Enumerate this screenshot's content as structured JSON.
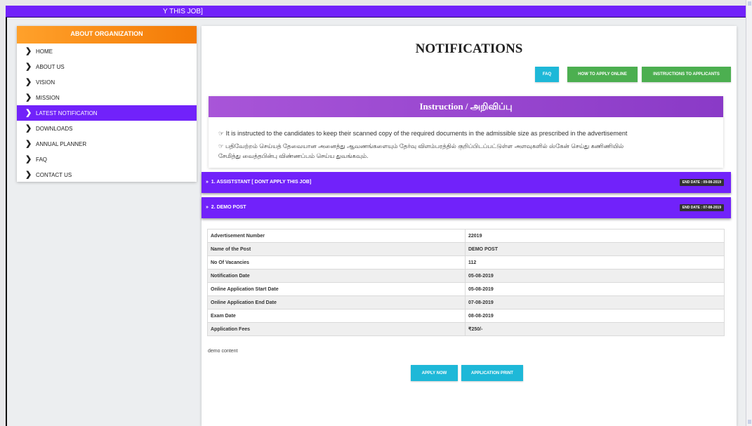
{
  "ticker": {
    "text": "Y THIS JOB]"
  },
  "sidebar": {
    "heading": "ABOUT ORGANIZATION",
    "items": [
      {
        "label": "HOME",
        "active": false
      },
      {
        "label": "ABOUT US",
        "active": false
      },
      {
        "label": "VISION",
        "active": false
      },
      {
        "label": "MISSION",
        "active": false
      },
      {
        "label": "LATEST NOTIFICATION",
        "active": true
      },
      {
        "label": "DOWNLOADS",
        "active": false
      },
      {
        "label": "ANNUAL PLANNER",
        "active": false
      },
      {
        "label": "FAQ",
        "active": false
      },
      {
        "label": "CONTACT US",
        "active": false
      }
    ]
  },
  "main": {
    "title": "NOTIFICATIONS",
    "buttons": {
      "faq": "FAQ",
      "how_to_apply": "HOW TO APPLY ONLINE",
      "instructions": "INSTRUCTIONS TO APPLICANTS"
    },
    "instruction": {
      "heading": "Instruction / அறிவிப்பு",
      "english": "It is instructed to the candidates to keep their scanned copy of the required documents in the admissible size as prescribed in the advertisement",
      "tamil_1": "பதிவேற்றம் செய்யத் தேவையான அனைத்து ஆவணங்களையும் தேர்வு விளம்பரத்தில் குறிப்பிடப்பட்டுள்ள அளவுகளில் ஸ்கேன் செய்து கணிணியில்",
      "tamil_2": "சேமித்து வைத்தபின்பு விண்ணப்பம் செய்ய துவங்கவும்."
    },
    "posts": [
      {
        "title": "1. ASSISTSTANT [ DONT APPLY THIS JOB]",
        "end_date": "END DATE : 09-08-2019"
      },
      {
        "title": "2. DEMO POST",
        "end_date": "END DATE : 07-08-2019"
      }
    ],
    "details": [
      {
        "label": "Advertisement Number",
        "value": "22019"
      },
      {
        "label": "Name of the Post",
        "value": "DEMO POST"
      },
      {
        "label": "No Of Vacancies",
        "value": "112"
      },
      {
        "label": "Notification Date",
        "value": "05-08-2019"
      },
      {
        "label": "Online Application Start Date",
        "value": "05-08-2019"
      },
      {
        "label": "Online Application End Date",
        "value": "07-08-2019"
      },
      {
        "label": "Exam Date",
        "value": "08-08-2019"
      },
      {
        "label": "Application Fees",
        "value": "₹250/-"
      }
    ],
    "description": "demo content",
    "apply_now": "APPLY NOW",
    "application_print": "APPLICATION PRINT"
  },
  "colors": {
    "primary": "#7122fa",
    "accent_orange": "#f47a05",
    "button_blue": "#1eb8d8",
    "button_green": "#4caf50",
    "instruction_purple": "#9b4ad0"
  }
}
